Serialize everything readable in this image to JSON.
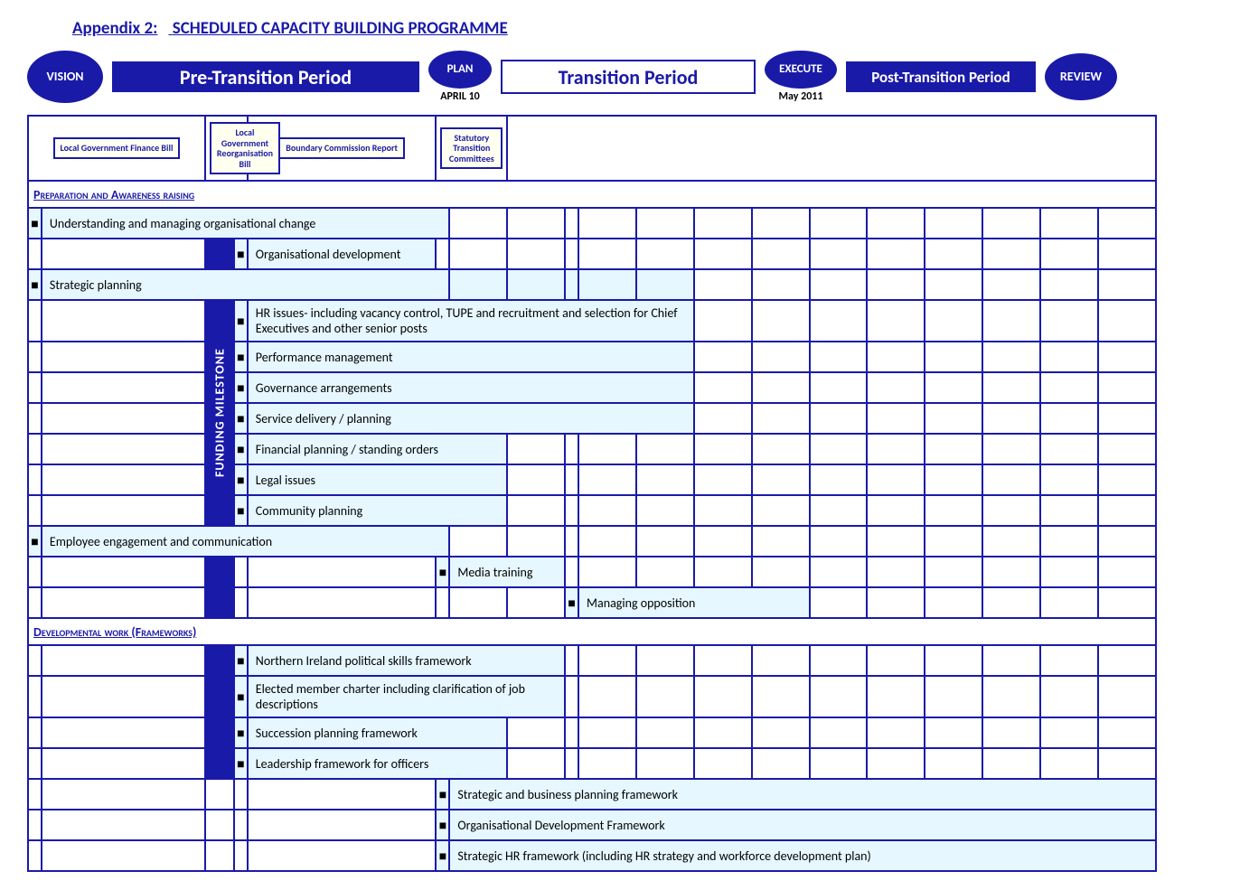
{
  "title": {
    "prefix": "Appendix 2:",
    "main": "SCHEDULED CAPACITY BUILDING PROGRAMME"
  },
  "header": {
    "vision": "VISION",
    "pre_period": "Pre-Transition Period",
    "plan": "PLAN",
    "plan_date": "APRIL 10",
    "transition": "Transition Period",
    "execute": "EXECUTE",
    "execute_date": "May 2011",
    "post_period": "Post-Transition Period",
    "review": "REVIEW"
  },
  "docboxes": [
    "Local Government Finance Bill",
    "Local Government Reorganisation Bill",
    "Boundary Commission Report",
    "Statutory Transition Committees"
  ],
  "milestone_label": "FUNDING MILESTONE",
  "sections": {
    "s1": "Preparation and Awareness raising",
    "s2": "Developmental work (Frameworks)"
  },
  "rows": {
    "r1": "Understanding and managing organisational change",
    "r2": "Organisational development",
    "r3": "Strategic planning",
    "r4": "HR issues- including vacancy control, TUPE and recruitment and selection for Chief Executives and other senior posts",
    "r5": "Performance management",
    "r6": "Governance arrangements",
    "r7": "Service delivery / planning",
    "r8": "Financial planning / standing orders",
    "r9": "Legal issues",
    "r10": "Community planning",
    "r11": "Employee engagement and communication",
    "r12": "Media training",
    "r13": "Managing opposition",
    "r14": "Northern Ireland political skills framework",
    "r15": "Elected member charter including clarification of job descriptions",
    "r16": "Succession planning framework",
    "r17": "Leadership framework for officers",
    "r18": "Strategic and business planning framework",
    "r19": "Organisational Development Framework",
    "r20": "Strategic HR framework (including HR strategy and workforce development plan)"
  }
}
